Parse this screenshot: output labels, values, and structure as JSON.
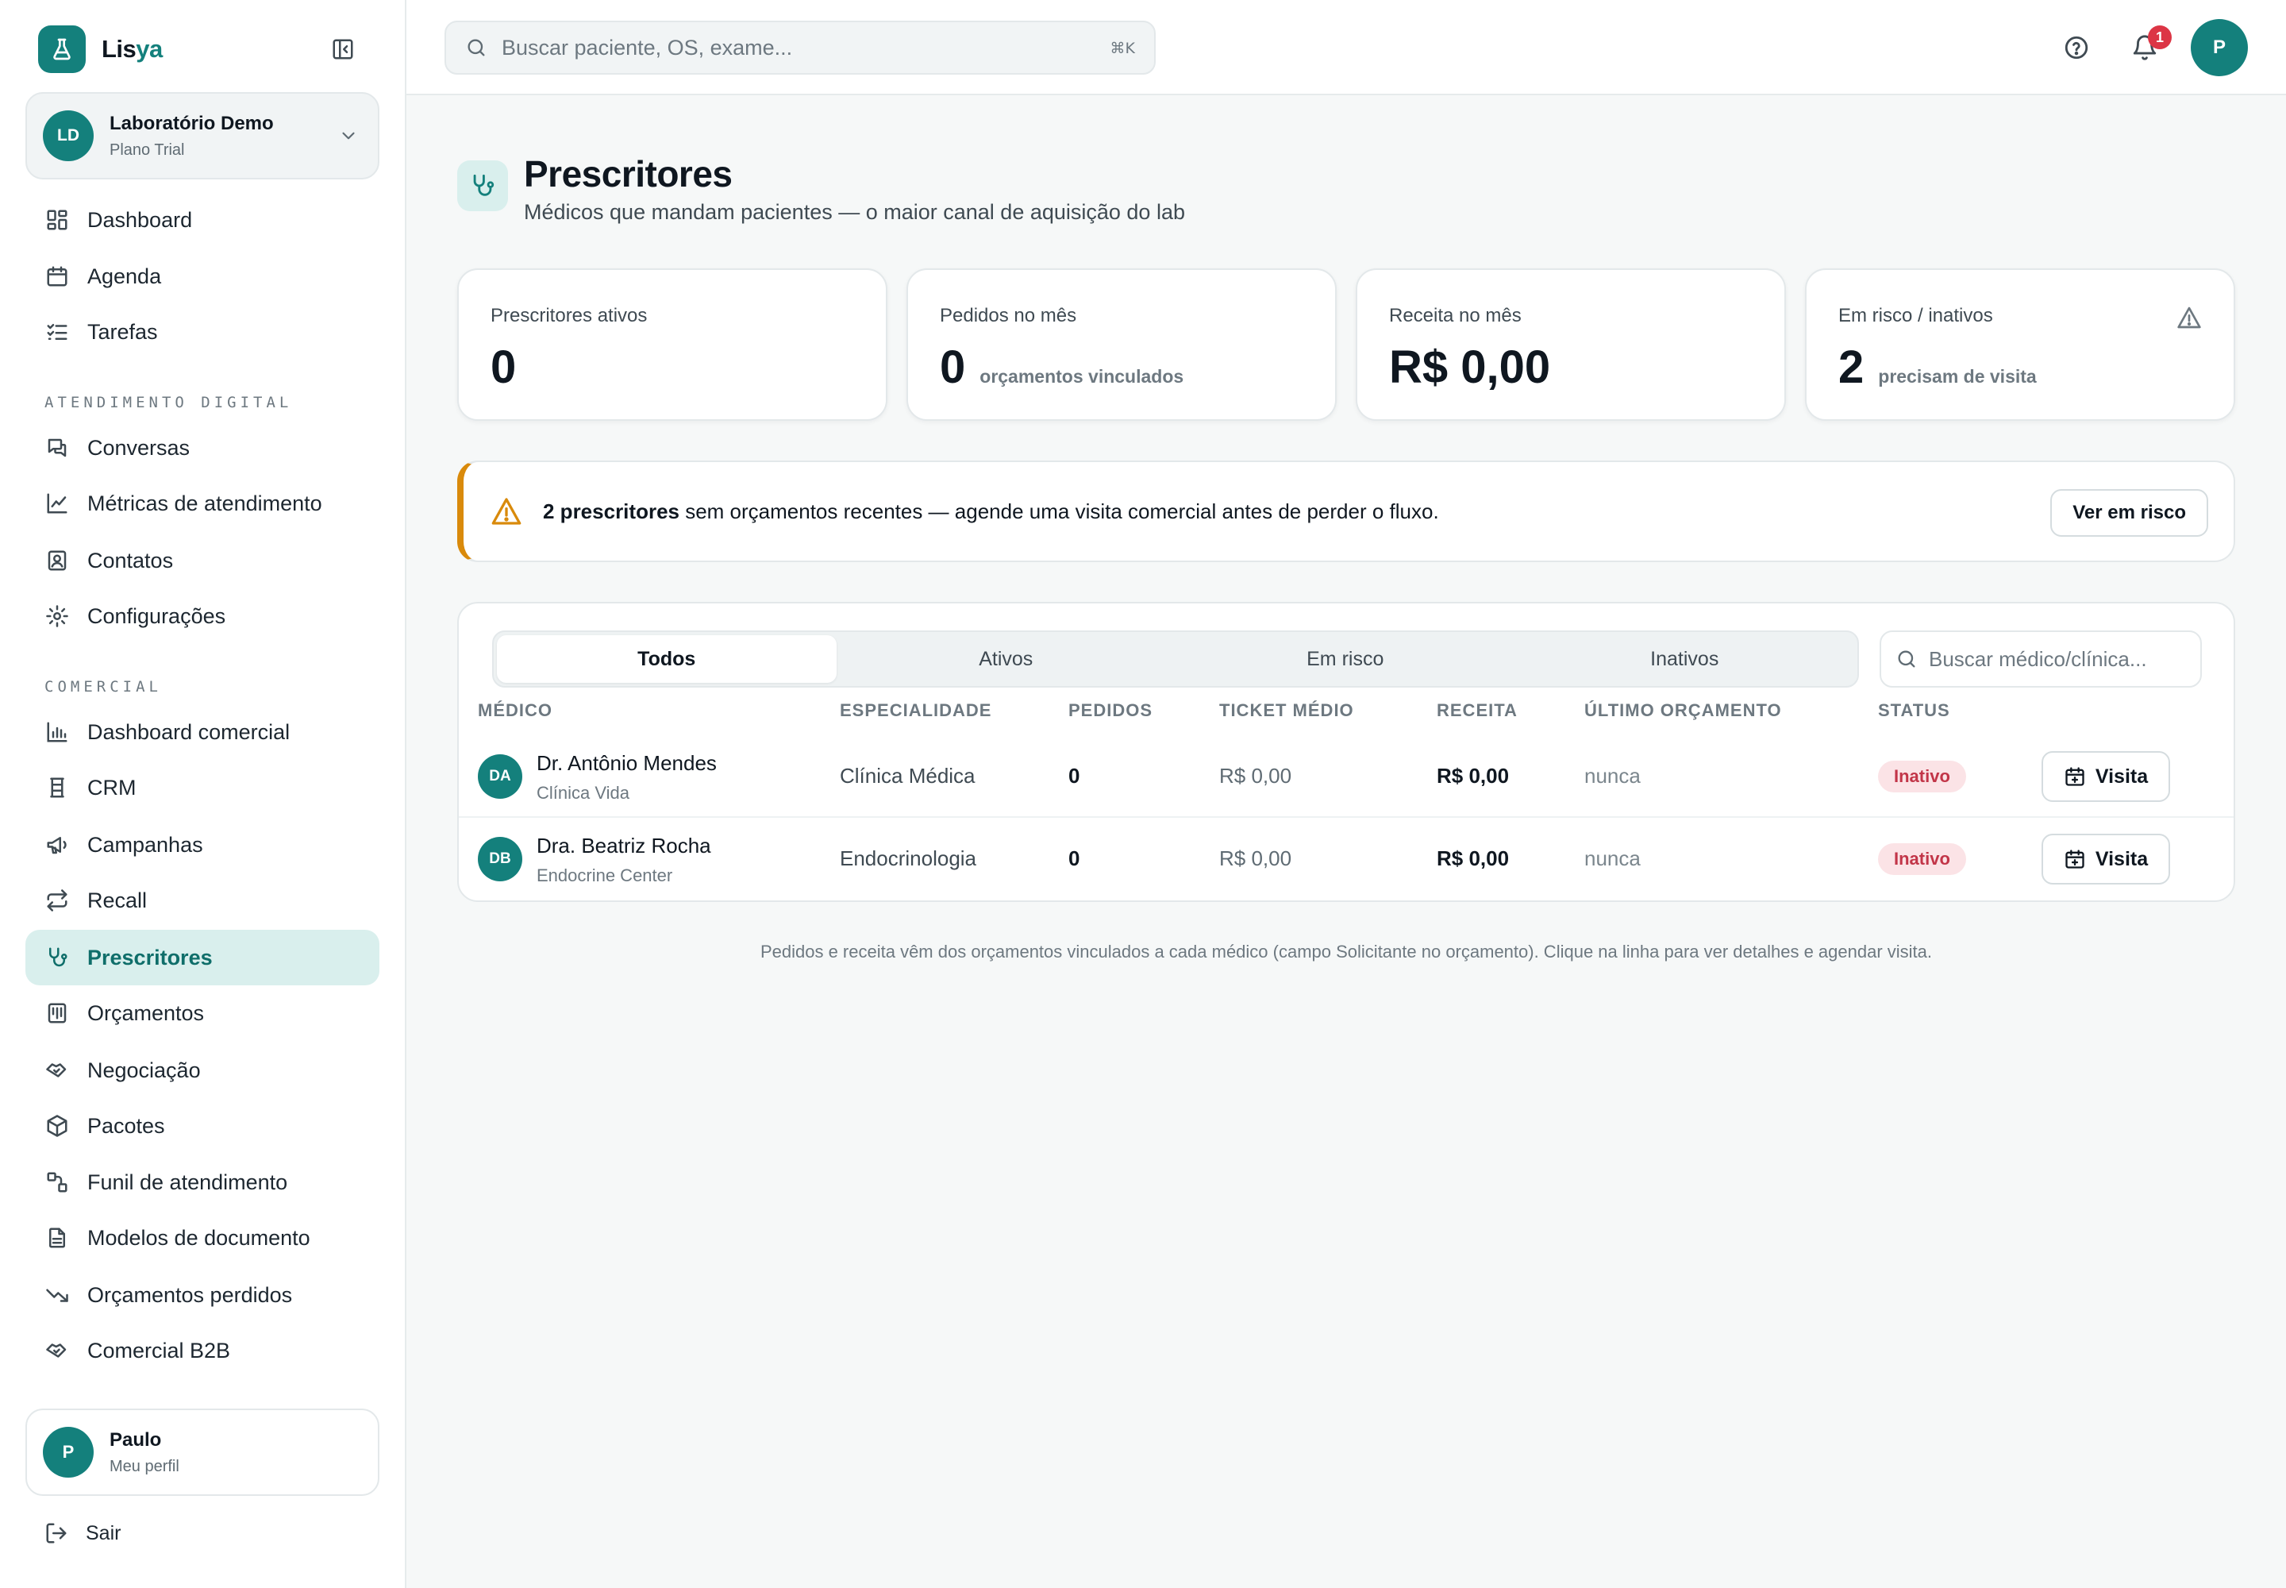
{
  "brand": {
    "name_part1": "Lis",
    "name_part2": "ya"
  },
  "org": {
    "initials": "LD",
    "name": "Laboratório Demo",
    "plan": "Plano Trial"
  },
  "sidebar": {
    "main": [
      {
        "label": "Dashboard",
        "icon": "grid-icon"
      },
      {
        "label": "Agenda",
        "icon": "calendar-icon"
      },
      {
        "label": "Tarefas",
        "icon": "checklist-icon"
      }
    ],
    "section_digital": "ATENDIMENTO DIGITAL",
    "digital": [
      {
        "label": "Conversas",
        "icon": "chat-icon"
      },
      {
        "label": "Métricas de atendimento",
        "icon": "line-chart-icon"
      },
      {
        "label": "Contatos",
        "icon": "contact-icon"
      },
      {
        "label": "Configurações",
        "icon": "gear-icon"
      }
    ],
    "section_comercial": "COMERCIAL",
    "comercial": [
      {
        "label": "Dashboard comercial",
        "icon": "bar-chart-icon"
      },
      {
        "label": "CRM",
        "icon": "crm-icon"
      },
      {
        "label": "Campanhas",
        "icon": "megaphone-icon"
      },
      {
        "label": "Recall",
        "icon": "repeat-icon"
      },
      {
        "label": "Prescritores",
        "icon": "stethoscope-icon",
        "active": true
      },
      {
        "label": "Orçamentos",
        "icon": "receipt-icon"
      },
      {
        "label": "Negociação",
        "icon": "handshake-icon"
      },
      {
        "label": "Pacotes",
        "icon": "package-icon"
      },
      {
        "label": "Funil de atendimento",
        "icon": "funnel-icon"
      },
      {
        "label": "Modelos de documento",
        "icon": "document-icon"
      },
      {
        "label": "Orçamentos perdidos",
        "icon": "trending-down-icon"
      },
      {
        "label": "Comercial B2B",
        "icon": "handshake-icon"
      }
    ]
  },
  "user": {
    "initial": "P",
    "name": "Paulo",
    "sub": "Meu perfil",
    "logout": "Sair"
  },
  "topbar": {
    "search_placeholder": "Buscar paciente, OS, exame...",
    "shortcut": "⌘K",
    "notifications": "1",
    "avatar": "P"
  },
  "page": {
    "title": "Prescritores",
    "subtitle": "Médicos que mandam pacientes — o maior canal de aquisição do lab"
  },
  "stats": [
    {
      "label": "Prescritores ativos",
      "value": "0",
      "note": ""
    },
    {
      "label": "Pedidos no mês",
      "value": "0",
      "note": "orçamentos vinculados"
    },
    {
      "label": "Receita no mês",
      "value": "R$ 0,00",
      "note": ""
    },
    {
      "label": "Em risco / inativos",
      "value": "2",
      "note": "precisam de visita"
    }
  ],
  "alert": {
    "bold": "2 prescritores",
    "text": " sem orçamentos recentes — agende uma visita comercial antes de perder o fluxo.",
    "button": "Ver em risco",
    "color": "#d98a0b"
  },
  "tabs": [
    "Todos",
    "Ativos",
    "Em risco",
    "Inativos"
  ],
  "table_search_placeholder": "Buscar médico/clínica...",
  "columns": [
    "MÉDICO",
    "ESPECIALIDADE",
    "PEDIDOS",
    "TICKET MÉDIO",
    "RECEITA",
    "ÚLTIMO ORÇAMENTO",
    "STATUS"
  ],
  "rows": [
    {
      "initials": "DA",
      "name": "Dr. Antônio Mendes",
      "clinic": "Clínica Vida",
      "specialty": "Clínica Médica",
      "orders": "0",
      "ticket": "R$ 0,00",
      "revenue": "R$ 0,00",
      "last": "nunca",
      "status": "Inativo",
      "action": "Visita"
    },
    {
      "initials": "DB",
      "name": "Dra. Beatriz Rocha",
      "clinic": "Endocrine Center",
      "specialty": "Endocrinologia",
      "orders": "0",
      "ticket": "R$ 0,00",
      "revenue": "R$ 0,00",
      "last": "nunca",
      "status": "Inativo",
      "action": "Visita"
    }
  ],
  "footnote": "Pedidos e receita vêm dos orçamentos vinculados a cada médico (campo Solicitante no orçamento). Clique na linha para ver detalhes e agendar visita.",
  "colors": {
    "brand": "#14807c",
    "active_bg": "#d9efed",
    "danger": "#dc3545",
    "warning": "#d98a0b"
  }
}
